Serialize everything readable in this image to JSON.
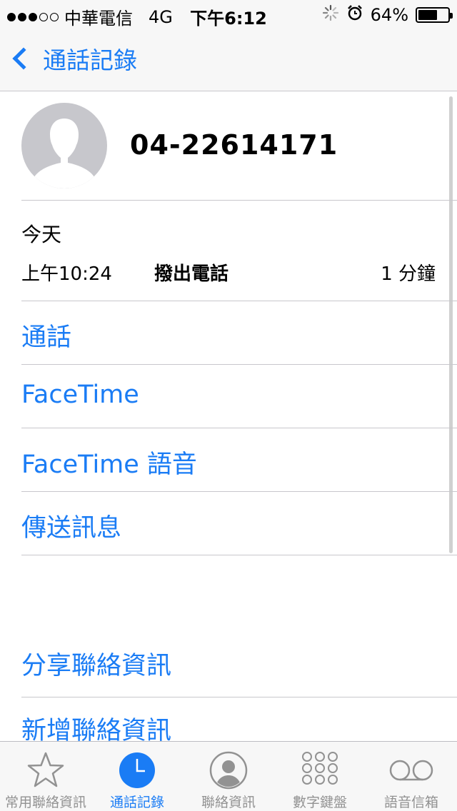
{
  "status_bar": {
    "carrier": "中華電信",
    "network": "4G",
    "time": "下午6:12",
    "battery_percent": "64%",
    "battery_level": 0.64,
    "signal_strength": 3,
    "signal_max": 5
  },
  "nav": {
    "back_label": "通話記錄"
  },
  "contact": {
    "phone_number": "04-22614171"
  },
  "call_history": {
    "date_label": "今天",
    "entries": [
      {
        "time": "上午10:24",
        "type": "撥出電話",
        "duration": "1 分鐘"
      }
    ]
  },
  "actions": {
    "call": "通話",
    "facetime": "FaceTime",
    "facetime_audio": "FaceTime 語音",
    "send_message": "傳送訊息",
    "share_contact": "分享聯絡資訊",
    "add_contact": "新增聯絡資訊"
  },
  "tabs": [
    {
      "label": "常用聯絡資訊",
      "icon": "star-icon",
      "active": false
    },
    {
      "label": "通話記錄",
      "icon": "clock-icon",
      "active": true
    },
    {
      "label": "聯絡資訊",
      "icon": "contacts-icon",
      "active": false
    },
    {
      "label": "數字鍵盤",
      "icon": "keypad-icon",
      "active": false
    },
    {
      "label": "語音信箱",
      "icon": "voicemail-icon",
      "active": false
    }
  ],
  "colors": {
    "accent": "#1a7cf5",
    "inactive": "#929292",
    "separator": "#c8c7cc",
    "bar_background": "#f7f7f7"
  }
}
